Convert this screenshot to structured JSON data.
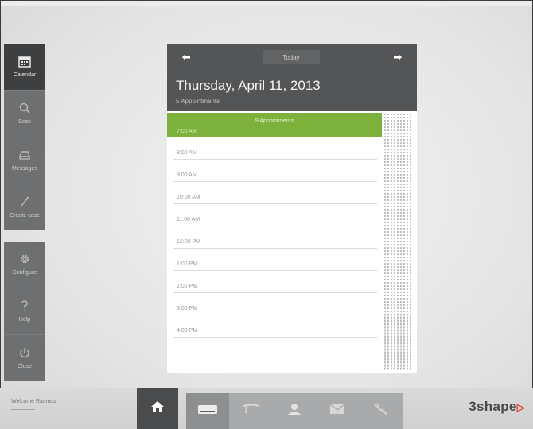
{
  "sidebar": {
    "items": [
      {
        "label": "Calendar",
        "icon": "calendar-icon",
        "active": true
      },
      {
        "label": "Scan",
        "icon": "search-icon"
      },
      {
        "label": "Messages",
        "icon": "messages-icon"
      },
      {
        "label": "Create case",
        "icon": "create-case-icon"
      }
    ],
    "items2": [
      {
        "label": "Configure",
        "icon": "gear-icon"
      },
      {
        "label": "Help",
        "icon": "help-icon"
      },
      {
        "label": "Close",
        "icon": "power-icon"
      }
    ]
  },
  "calendar": {
    "today_label": "Today",
    "date_title": "Thursday, April 11, 2013",
    "date_subtitle": "5 Appointments",
    "appointment_label": "9 Appointments",
    "slots": [
      "7:00 AM",
      "8:00 AM",
      "9:00 AM",
      "10:00 AM",
      "11:00 AM",
      "12:00 PM",
      "1:00 PM",
      "2:00 PM",
      "3:00 PM",
      "4:00 PM"
    ]
  },
  "bottombar": {
    "user_text": "Welcome Rasmus",
    "brand": "3shape",
    "tools": [
      "scanner-icon",
      "tooth-icon",
      "patient-icon",
      "mail-icon",
      "tools-icon"
    ]
  },
  "colors": {
    "accent_green": "#7cb13b",
    "header_dark": "#545556",
    "sidebar_gray": "#6e6f70",
    "brand_red": "#e5401f"
  }
}
